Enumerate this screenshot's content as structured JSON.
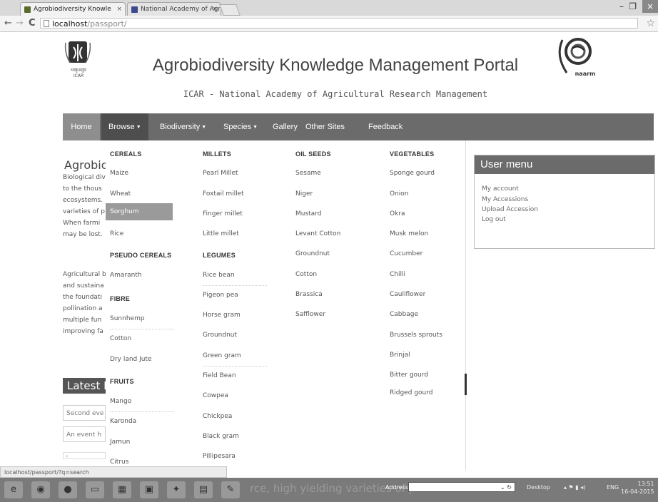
{
  "browser": {
    "tabs": [
      {
        "title": "Agrobiodiversity Knowle",
        "close": "×"
      },
      {
        "title": "National Academy of Agr",
        "close": "×"
      }
    ],
    "window_controls": {
      "minimize": "–",
      "maximize": "❐",
      "close": "×"
    },
    "nav": {
      "back": "←",
      "forward": "→",
      "reload": "C"
    },
    "url_host": "localhost",
    "url_path": "/passport/",
    "bookmark_star": "☆",
    "status_url": "localhost/passport/?q=search"
  },
  "header": {
    "title": "Agrobiodiversity Knowledge Management Portal",
    "subtitle": "ICAR - National Academy of Agricultural Research Management",
    "left_logo_caption": "ICAR",
    "right_logo_caption": "naarm"
  },
  "nav": {
    "home": "Home",
    "browse": "Browse",
    "biodiversity": "Biodiversity",
    "species": "Species",
    "gallery": "Gallery",
    "other_sites": "Other Sites",
    "feedback": "Feedback",
    "caret": "▼"
  },
  "dropdown": {
    "col1": [
      {
        "heading": "CEREALS",
        "items": [
          "Maize",
          "Wheat",
          "Sorghum",
          "Rice"
        ]
      },
      {
        "heading": "PSEUDO CEREALS",
        "items": [
          "Amaranth"
        ]
      },
      {
        "heading": "FIBRE",
        "items": [
          "Sunnhemp",
          "Cotton",
          "Dry land Jute"
        ]
      },
      {
        "heading": "FRUITS",
        "items": [
          "Mango",
          "Karonda",
          "Jamun",
          "Citrus"
        ]
      }
    ],
    "col2": [
      {
        "heading": "MILLETS",
        "items": [
          "Pearl Millet",
          "Foxtail millet",
          "Finger millet",
          "Little millet"
        ]
      },
      {
        "heading": "LEGUMES",
        "items": [
          "Rice bean",
          "Pigeon pea",
          "Horse gram",
          "Groundnut",
          "Green gram",
          "Field Bean",
          "Cowpea",
          "Chickpea",
          "Black gram",
          "Pillipesara"
        ]
      }
    ],
    "col3": [
      {
        "heading": "OIL SEEDS",
        "items": [
          "Sesame",
          "Niger",
          "Mustard",
          "Levant Cotton",
          "Groundnut",
          "Cotton",
          "Brassica",
          "Safflower"
        ]
      }
    ],
    "col4": [
      {
        "heading": "VEGETABLES",
        "items": [
          "Sponge gourd",
          "Onion",
          "Okra",
          "Musk melon",
          "Cucumber",
          "Chilli",
          "Cauliflower",
          "Cabbage",
          "Brussels sprouts",
          "Brinjal",
          "Bitter gourd",
          "Ridged gourd"
        ]
      }
    ],
    "highlighted": "Sorghum"
  },
  "main": {
    "heading_fragment": "Agrobio",
    "para1": [
      "Biological div",
      "to the thous",
      "ecosystems.",
      "varieties of p",
      "When farmi",
      "may be lost."
    ],
    "para2": [
      "Agricultural b",
      "and sustaina",
      "the foundati",
      "pollination a",
      "multiple fun",
      "improving fa"
    ],
    "latest_fragment": "Latest N",
    "events": [
      "Second eve",
      "An event h"
    ],
    "events_nav": "‹"
  },
  "user_menu": {
    "title": "User menu",
    "links": [
      "My account",
      "My Accessions",
      "Upload Accession",
      "Log out"
    ]
  },
  "taskbar": {
    "ghost_text": "rce, high yielding varieties of plants and",
    "address_label": "Address",
    "address_refresh": "⌄ ↻",
    "desktop": "Desktop",
    "lang": "ENG",
    "time": "13:51",
    "date": "16-04-2015"
  },
  "colors": {
    "nav_bg": "#6b6b6b",
    "highlight_bg": "#9a9a9a",
    "taskbar_bg": "#7a7a7a"
  }
}
